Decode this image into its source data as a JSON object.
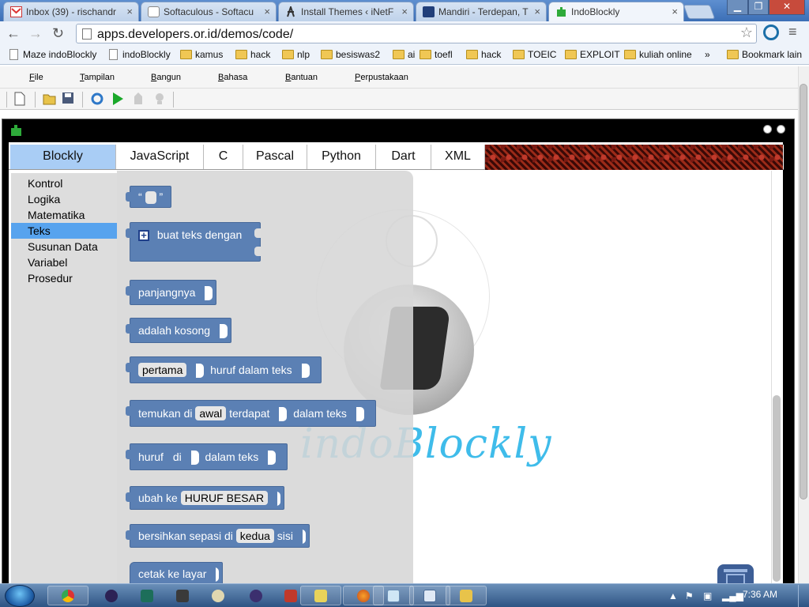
{
  "browser": {
    "tabs": [
      {
        "title": "Inbox (39) - rischandr",
        "icon": "gmail-icon",
        "active": false
      },
      {
        "title": "Softaculous - Softacu",
        "icon": "softaculous-icon",
        "active": false
      },
      {
        "title": "Install Themes ‹ iNetF",
        "icon": "wordpress-icon",
        "active": false
      },
      {
        "title": "Mandiri - Terdepan, T",
        "icon": "mandiri-icon",
        "active": false
      },
      {
        "title": "IndoBlockly",
        "icon": "puzzle-icon",
        "active": true
      }
    ],
    "close_glyph": "×",
    "url": "apps.developers.or.id/demos/code/",
    "bookmarks": [
      {
        "label": "Maze indoBlockly",
        "type": "page"
      },
      {
        "label": "indoBlockly",
        "type": "page"
      },
      {
        "label": "kamus",
        "type": "folder"
      },
      {
        "label": "hack",
        "type": "folder"
      },
      {
        "label": "nlp",
        "type": "folder"
      },
      {
        "label": "besiswas2",
        "type": "folder"
      },
      {
        "label": "ai",
        "type": "folder"
      },
      {
        "label": "toefl",
        "type": "folder"
      },
      {
        "label": "hack",
        "type": "folder"
      },
      {
        "label": "TOEIC",
        "type": "folder"
      },
      {
        "label": "EXPLOIT",
        "type": "folder"
      },
      {
        "label": "kuliah online",
        "type": "folder"
      }
    ],
    "bookmarks_overflow": "»",
    "other_bookmarks": "Bookmark lain"
  },
  "app": {
    "menu": [
      "File",
      "Tampilan",
      "Bangun",
      "Bahasa",
      "Bantuan",
      "Perpustakaan"
    ],
    "toolbar_icons": [
      "new-file-icon",
      "open-folder-icon",
      "save-icon",
      "refresh-icon",
      "run-icon",
      "upload-icon",
      "bulb-icon"
    ],
    "lang_tabs": [
      "Blockly",
      "JavaScript",
      "C",
      "Pascal",
      "Python",
      "Dart",
      "XML"
    ],
    "active_lang_tab": "Blockly",
    "categories": [
      "Kontrol",
      "Logika",
      "Matematika",
      "Teks",
      "Susunan Data",
      "Variabel",
      "Prosedur"
    ],
    "selected_category": "Teks",
    "blocks": {
      "text_quote_open": "“",
      "text_quote_close": "”",
      "join_label": "buat teks dengan",
      "length": "panjangnya",
      "is_empty": "adalah kosong",
      "char_at_field": "pertama",
      "char_at_label": "huruf dalam teks",
      "find_prefix": "temukan di",
      "find_field": "awal",
      "find_mid": "terdapat",
      "find_suffix": "dalam teks",
      "get_letter_prefix": "huruf",
      "get_letter_mid": "di",
      "get_letter_suffix": "dalam teks",
      "change_case_prefix": "ubah ke",
      "change_case_field": "HURUF BESAR",
      "trim_prefix": "bersihkan sepasi di",
      "trim_field": "kedua",
      "trim_suffix": "sisi",
      "print": "cetak ke layar"
    },
    "logo_text": "indoBlockly"
  },
  "taskbar": {
    "clock": "7:36 AM",
    "apps": [
      "chrome-icon",
      "eclipse-icon",
      "app-icon",
      "paint-icon",
      "eclipse-icon",
      "app-icon",
      "app-icon",
      "firefox-icon",
      "notepad-icon",
      "window-icon",
      "explorer-icon"
    ]
  },
  "colors": {
    "block_blue": "#5b80b4",
    "selected_category": "#57a3ee",
    "active_lang_tab": "#a9cdf5",
    "logo_cyan": "#2bb5e8"
  }
}
